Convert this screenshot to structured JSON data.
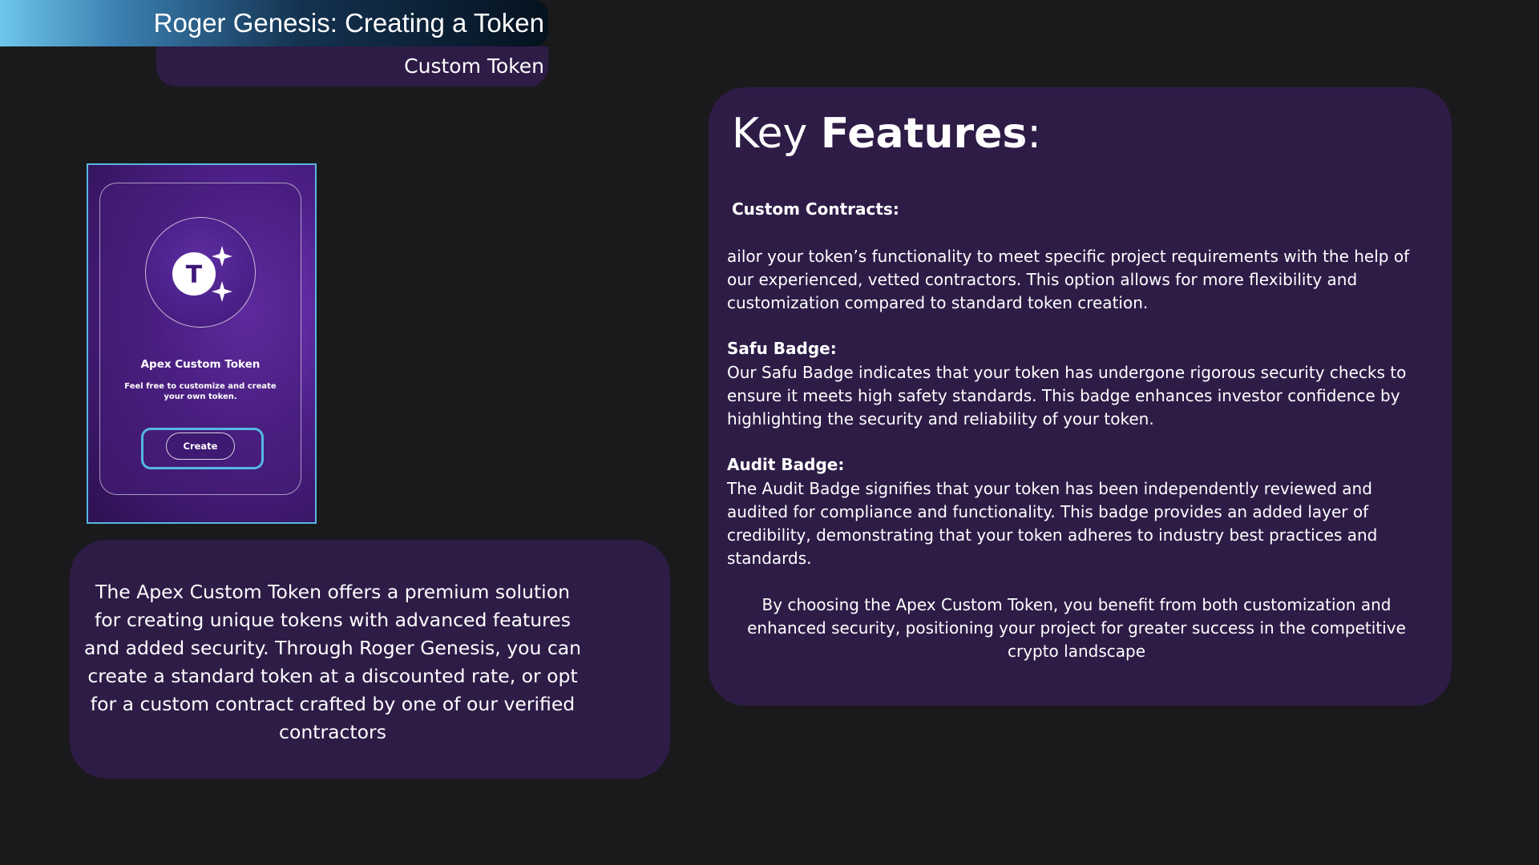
{
  "header": {
    "title": "Roger Genesis: Creating a Token",
    "subtitle": "Custom Token"
  },
  "mockup": {
    "token_letter": "T",
    "card_title": "Apex Custom Token",
    "card_description": "Feel free to customize and create your own token.",
    "create_button": "Create",
    "icon": "token-sparkle-icon"
  },
  "description": {
    "text": "The Apex Custom Token offers a premium solution for creating unique tokens with advanced features and added security. Through Roger Genesis, you can create a standard token at a discounted rate, or opt for a custom contract crafted by one of our verified contractors"
  },
  "features": {
    "heading_light": "Key ",
    "heading_bold": "Features",
    "heading_colon": ":",
    "items": [
      {
        "label": "Custom Contracts:",
        "body": "ailor your token’s functionality to meet specific project requirements with the help of our experienced, vetted contractors. This option allows for more flexibility and customization compared to standard token creation."
      },
      {
        "label": "Safu Badge:",
        "body": "Our Safu Badge indicates that your token has undergone rigorous security checks to ensure it meets high safety standards. This badge enhances investor confidence by highlighting the security and reliability of your token."
      },
      {
        "label": "Audit Badge:",
        "body": "The Audit Badge signifies that your token has been independently reviewed and audited for compliance and functionality. This badge provides an added layer of credibility, demonstrating that your token adheres to industry best practices and standards."
      }
    ],
    "closing": "By choosing the Apex Custom Token, you benefit from both customization and enhanced security, positioning your project for greater success in the competitive crypto landscape"
  },
  "colors": {
    "background": "#1a1a1c",
    "panel": "#2e1c47",
    "accent_blue": "#56b7e2",
    "accent_purple": "#7b3bc8"
  }
}
